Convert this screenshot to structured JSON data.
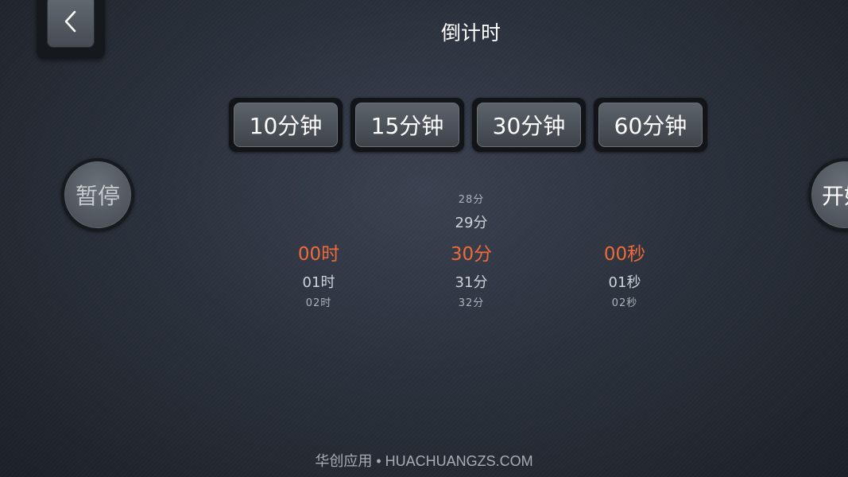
{
  "header": {
    "title": "倒计时",
    "back_icon": "chevron-left-icon"
  },
  "presets": [
    {
      "label": "10分钟"
    },
    {
      "label": "15分钟"
    },
    {
      "label": "30分钟"
    },
    {
      "label": "60分钟"
    }
  ],
  "controls": {
    "pause_label": "暂停",
    "start_label": "开始"
  },
  "picker": {
    "hours": {
      "prev2": "",
      "prev1": "",
      "selected": "00时",
      "next1": "01时",
      "next2": "02时"
    },
    "minutes": {
      "prev2": "28分",
      "prev1": "29分",
      "selected": "30分",
      "next1": "31分",
      "next2": "32分"
    },
    "seconds": {
      "prev2": "",
      "prev1": "",
      "selected": "00秒",
      "next1": "01秒",
      "next2": "02秒"
    }
  },
  "watermark": "华创应用 • HUACHUANGZS.COM",
  "colors": {
    "selected": "#ef6a3a",
    "text": "#ffffff"
  }
}
